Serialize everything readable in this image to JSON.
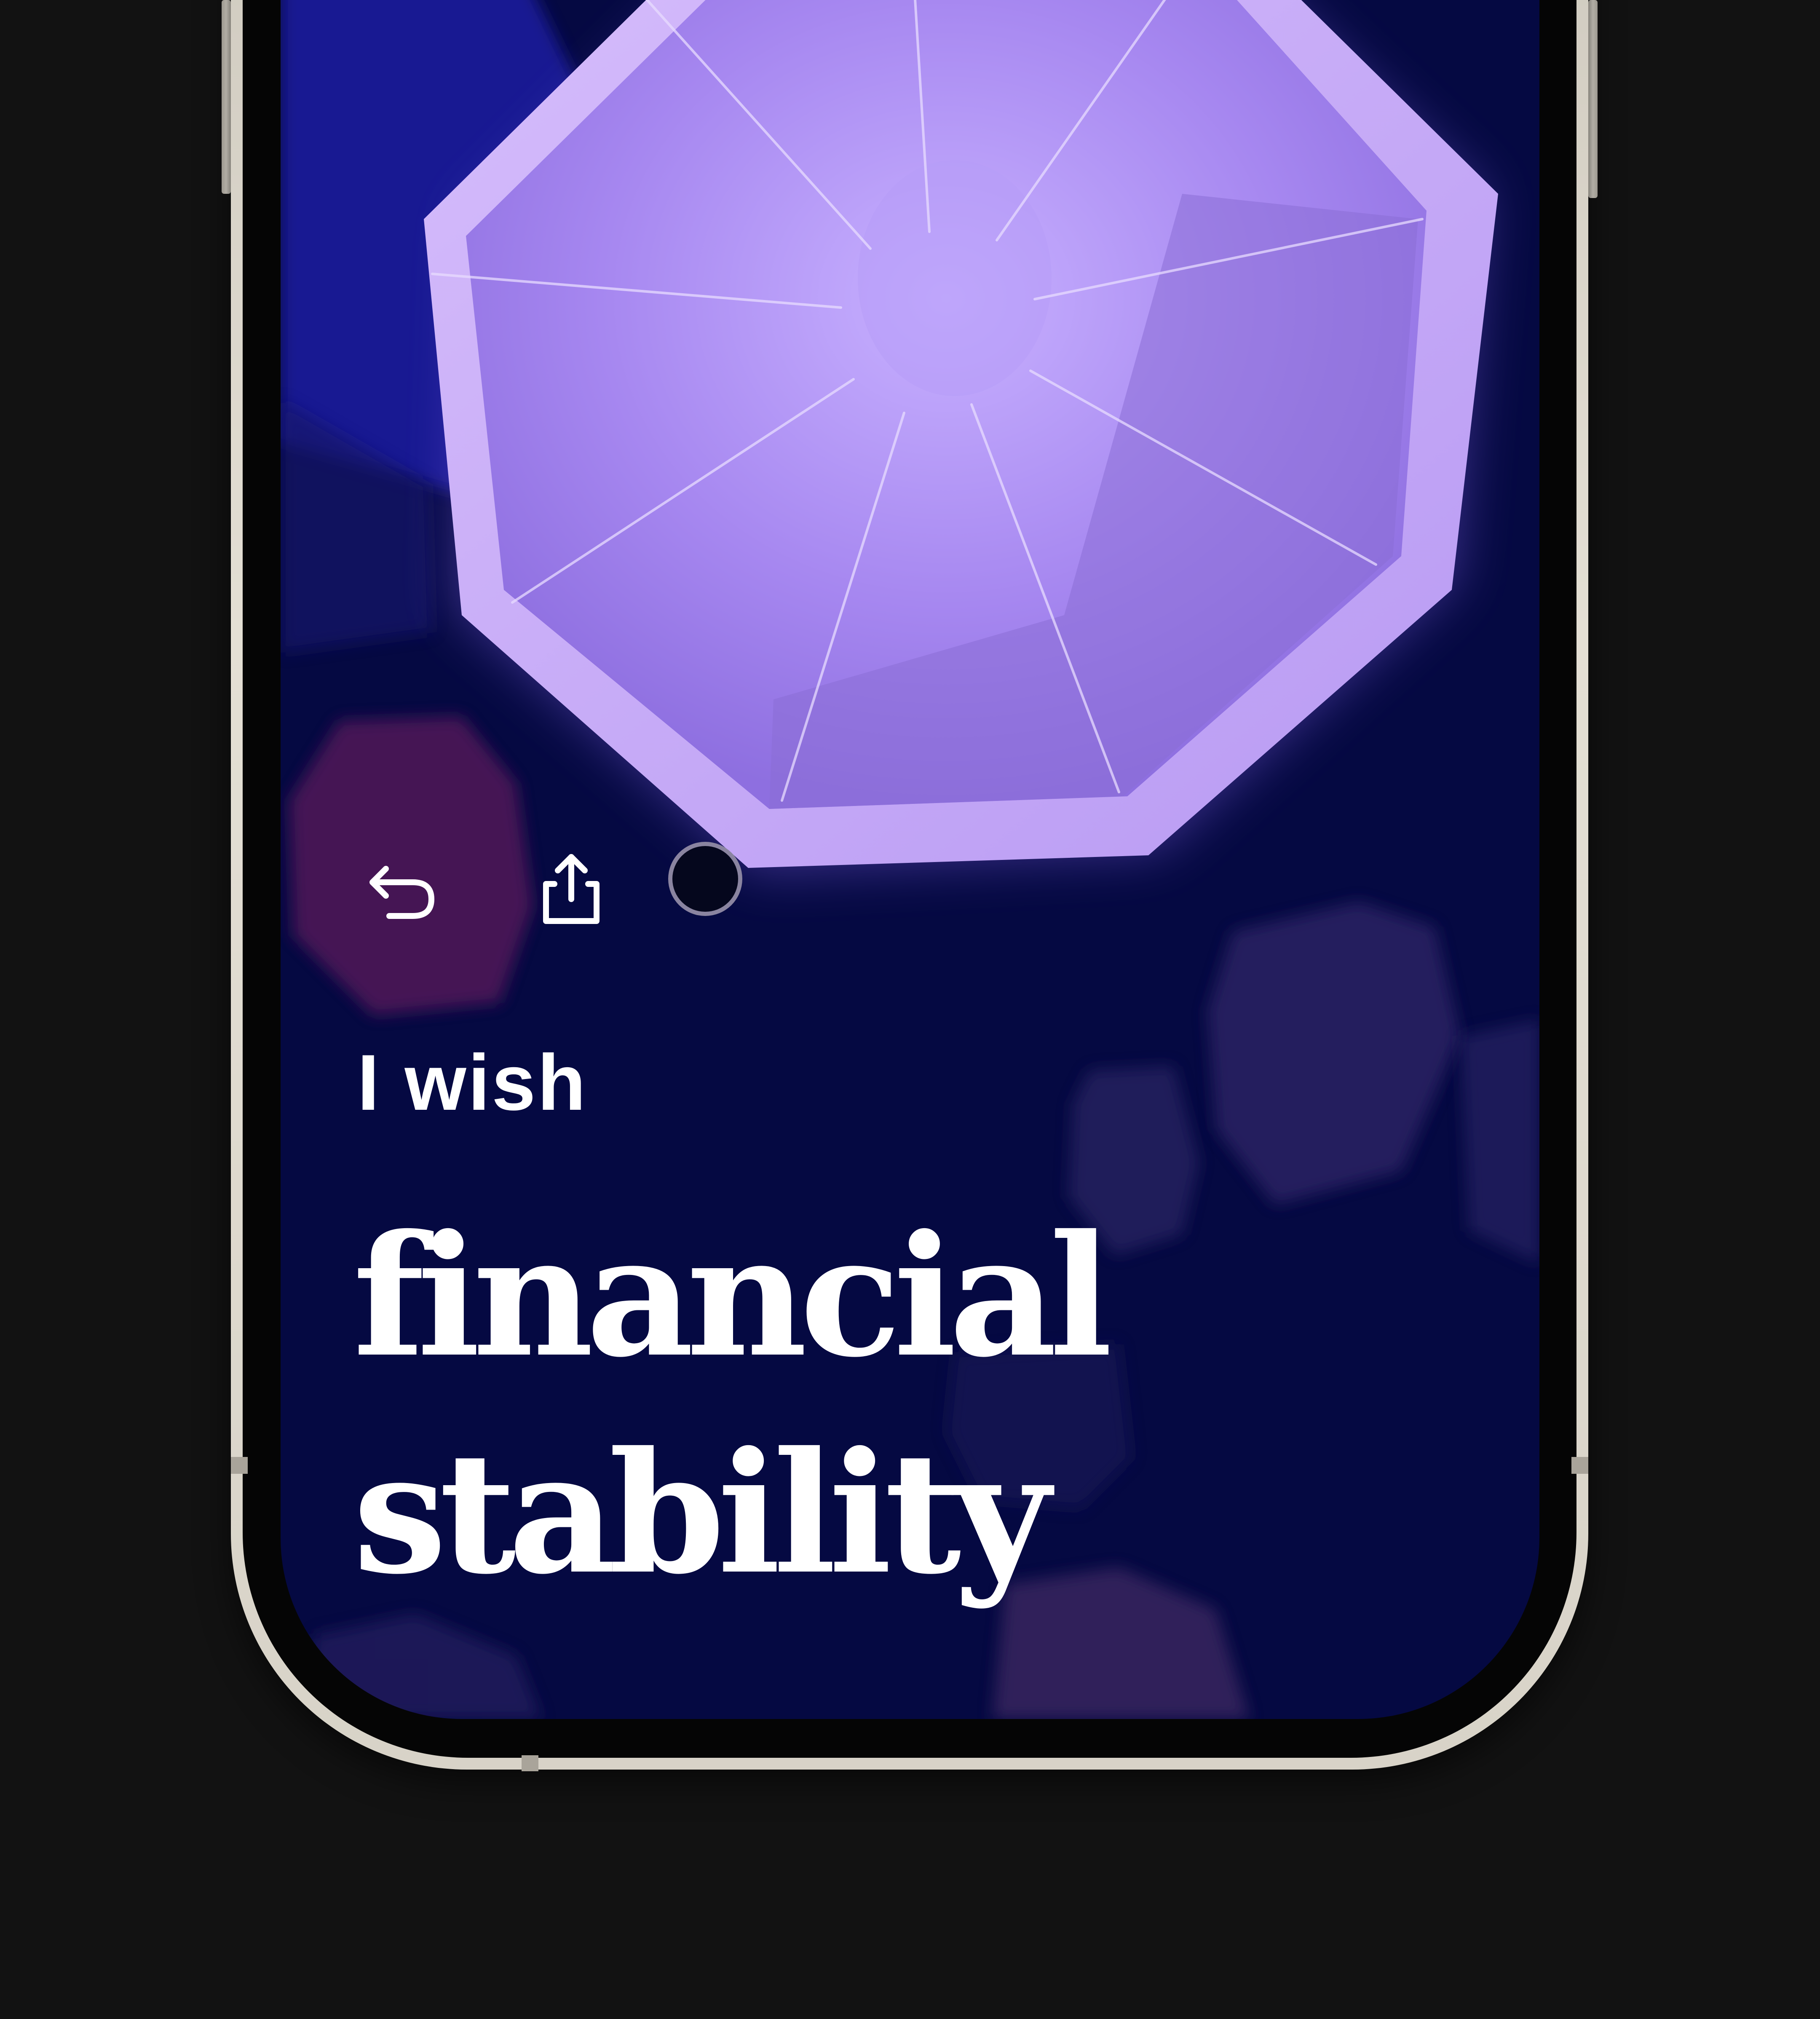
{
  "screen": {
    "background_color": "#050942",
    "accent_color": "#a585ee",
    "text_color": "#ffffff"
  },
  "controls": {
    "undo_icon": "undo-arrow-icon",
    "share_icon": "share-icon",
    "record_icon": "record-circle"
  },
  "wish": {
    "prefix": "I wish",
    "line1": "financial",
    "line2": "stability"
  }
}
